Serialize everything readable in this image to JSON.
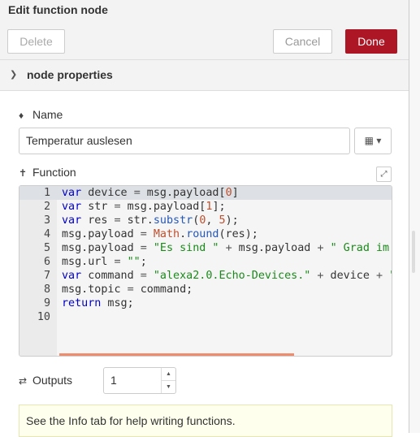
{
  "dialog": {
    "title": "Edit function node"
  },
  "toolbar": {
    "delete_label": "Delete",
    "cancel_label": "Cancel",
    "done_label": "Done",
    "done_color": "#ad1625"
  },
  "section": {
    "label": "node properties",
    "chevron_icon": "chevron-down-icon"
  },
  "name_field": {
    "label": "Name",
    "icon": "tag-icon",
    "value": "Temperatur auslesen",
    "library_button_icon": "book-icon"
  },
  "function_field": {
    "label": "Function",
    "icon": "wrench-icon",
    "expand_icon": "expand-icon"
  },
  "code": {
    "line_numbers": [
      "1",
      "2",
      "3",
      "4",
      "5",
      "6",
      "7",
      "8",
      "9",
      "10"
    ],
    "lines": [
      "var device = msg.payload[0]",
      "var str = msg.payload[1];",
      "var res = str.substr(0, 5);",
      "msg.payload = Math.round(res);",
      "msg.payload = \"Es sind \" + msg.payload + \" Grad im",
      "msg.url = \"\";",
      "var command = \"alexa2.0.Echo-Devices.\" + device + \"",
      "msg.topic = command;",
      "return msg;",
      ""
    ]
  },
  "outputs_field": {
    "label": "Outputs",
    "icon": "shuffle-icon",
    "value": "1"
  },
  "tip": {
    "text": "See the Info tab for help writing functions."
  }
}
